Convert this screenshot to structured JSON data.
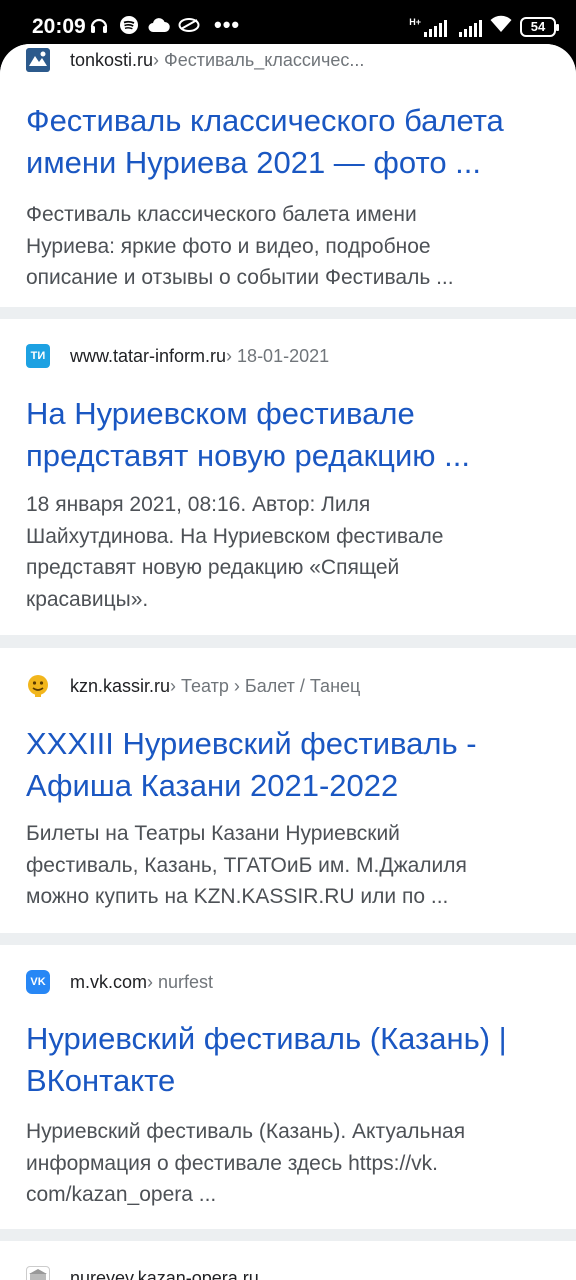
{
  "status_bar": {
    "time": "20:09",
    "icons": [
      "headphones-icon",
      "spotify-icon",
      "cloud-icon",
      "app-icon",
      "more-dots-icon"
    ],
    "network": "H+",
    "battery": "54"
  },
  "results": [
    {
      "domain": "tonkosti.ru",
      "crumb": " › Фестиваль_классичес...",
      "favicon": "tonkosti-logo-icon",
      "title_lines": [
        "Фестиваль классического балета",
        "имени Нуриева 2021 — фото ..."
      ],
      "snippet_lines": [
        "Фестиваль классического балета имени",
        "Нуриева: яркие фото и видео, подробное",
        "описание и отзывы о событии Фестиваль ..."
      ]
    },
    {
      "domain": "www.tatar-inform.ru",
      "crumb": " › 18-01-2021",
      "favicon": "tatar-inform-logo-icon",
      "favicon_text": "ТИ",
      "title_lines": [
        "На Нуриевском фестивале",
        "представят новую редакцию ..."
      ],
      "snippet_lines": [
        "18 января 2021, 08:16. Автор: Лиля",
        "Шайхутдинова. На Нуриевском фестивале",
        "представят новую редакцию «Спящей",
        "красавицы»."
      ]
    },
    {
      "domain": "kzn.kassir.ru",
      "crumb": " › Театр › Балет / Танец",
      "favicon": "kassir-logo-icon",
      "title_lines": [
        "XXXIII Нуриевский фестиваль -",
        "Афиша Казани 2021-2022"
      ],
      "snippet_lines": [
        "Билеты на Театры Казани Нуриевский",
        "фестиваль, Казань, ТГАТОиБ им. М.Джалиля",
        "можно купить на KZN.KASSIR.RU или по ..."
      ]
    },
    {
      "domain": "m.vk.com",
      "crumb": " › nurfest",
      "favicon": "vk-logo-icon",
      "favicon_text": "VK",
      "title_lines": [
        "Нуриевский фестиваль (Казань) |",
        "ВКонтакте"
      ],
      "snippet_lines": [
        "Нуриевский фестиваль (Казань). Актуальная",
        "информация о фестивале здесь https://vk.",
        "com/kazan_opera ..."
      ]
    },
    {
      "domain": "nureyev.kazan-opera.ru",
      "crumb": "",
      "favicon": "kazan-opera-logo-icon"
    }
  ],
  "colors": {
    "link": "#1a57c2",
    "snippet": "#4d5156",
    "separator": "#eceff1"
  }
}
